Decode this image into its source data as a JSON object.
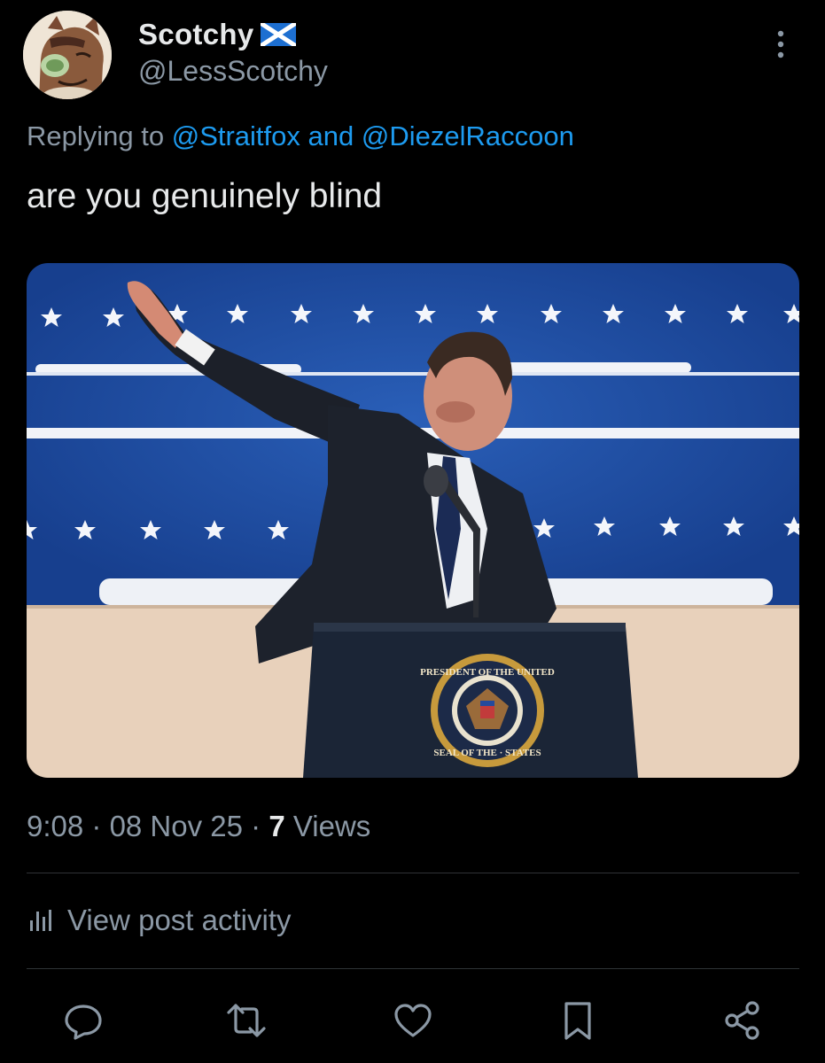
{
  "author": {
    "display_name": "Scotchy",
    "handle": "@LessScotchy",
    "flag_icon": "scotland-flag-icon"
  },
  "reply_context": {
    "prefix": "Replying to",
    "mention_1": "@Straitfox",
    "joiner": "and",
    "mention_2": "@DiezelRaccoon"
  },
  "post": {
    "text": "are you genuinely blind"
  },
  "media": {
    "seal_text_top": "PRESIDENT OF THE UNITED",
    "seal_text_bottom": "SEAL OF THE · STATES"
  },
  "meta": {
    "time": "9:08",
    "separator": " · ",
    "date": "08 Nov 25",
    "views_count": "7",
    "views_label": "Views"
  },
  "activity": {
    "label": "View post activity",
    "icon": "analytics-icon"
  },
  "actions": [
    "reply-icon",
    "repost-icon",
    "like-icon",
    "bookmark-icon",
    "share-icon"
  ],
  "colors": {
    "background": "#000000",
    "text": "#e7e9ea",
    "muted": "#8b98a5",
    "link": "#1d9bf0",
    "stage_blue": "#1e4fa6",
    "stage_beige": "#e9d2bc"
  }
}
